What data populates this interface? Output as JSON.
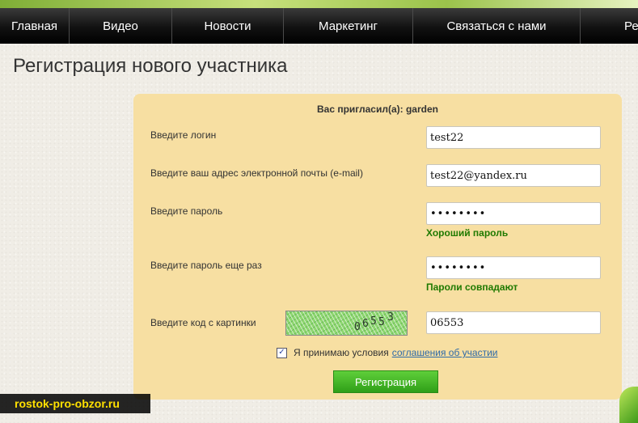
{
  "nav": {
    "items": [
      "Главная",
      "Видео",
      "Новости",
      "Маркетинг",
      "Связаться с нами",
      "Ре"
    ]
  },
  "page": {
    "title": "Регистрация нового участника"
  },
  "form": {
    "invited": "Вас пригласил(а): garden",
    "login_label": "Введите логин",
    "login_value": "test22",
    "email_label": "Введите ваш адрес электронной почты (e-mail)",
    "email_value": "test22@yandex.ru",
    "password_label": "Введите пароль",
    "password_value": "••••••••",
    "password_status": "Хороший пароль",
    "password2_label": "Введите пароль еще раз",
    "password2_value": "••••••••",
    "password2_status": "Пароли совпадают",
    "captcha_label": "Введите код с картинки",
    "captcha_chars": [
      "0",
      "6",
      "5",
      "5",
      "3"
    ],
    "captcha_value": "06553",
    "agree_checked": true,
    "agree_text": "Я принимаю условия",
    "agree_link": "соглашения об участии",
    "submit_label": "Регистрация"
  },
  "watermark": "rostok-pro-obzor.ru",
  "colors": {
    "panel": "#f7dfa2",
    "status_green": "#1f7a00",
    "button_green": "#3bb022",
    "link_blue": "#2e6aa8",
    "watermark_yellow": "#ffe000"
  }
}
